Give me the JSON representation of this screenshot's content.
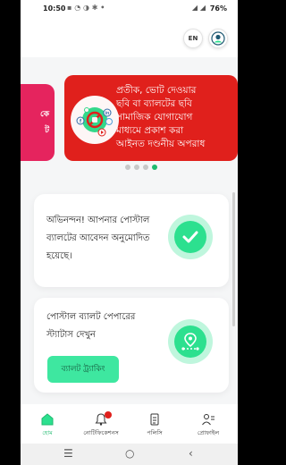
{
  "status_bar": {
    "time": "10:50",
    "notif_icons": "▪ ◔ ◑ ✱ •",
    "signal": "◢ ◢",
    "battery": "76%"
  },
  "header": {
    "language": "EN"
  },
  "carousel": {
    "prev_slide_text": [
      "কে",
      "ট"
    ],
    "main_slide_lines": [
      "প্রতীক, ভোট দেওয়ার",
      "ছবি বা ব্যালটের ছবি",
      "সামাজিক যোগাযোগ",
      "মাধ্যমে প্রকাশ করা",
      "আইনত দণ্ডনীয় অপরাধ"
    ],
    "dots": 4,
    "active_dot": 3
  },
  "approval_card": {
    "lines": [
      "অভিনন্দন! আপনার পোস্টাল",
      "ব্যালটের আবেদন অনুমোদিত",
      "হয়েছে।"
    ]
  },
  "tracking_card": {
    "lines": [
      "পোস্টাল ব্যালট পেপারের",
      "স্ট্যাটাস দেখুন"
    ],
    "button": "ব্যালট ট্র্যাকিং"
  },
  "bottom_nav": {
    "items": [
      {
        "label": "হোম"
      },
      {
        "label": "নোটিফিকেশনস"
      },
      {
        "label": "পলিসি"
      },
      {
        "label": "প্রোফাইল"
      }
    ]
  },
  "system_nav": {
    "recents": "☰",
    "home": "○",
    "back": "‹"
  },
  "colors": {
    "accent": "#1fba6f",
    "badge_green": "#2ce08f",
    "alert_red": "#e0201c",
    "prev_slide_pink": "#e5245e"
  }
}
